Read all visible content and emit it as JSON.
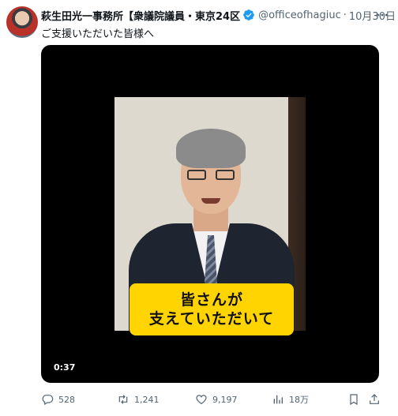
{
  "tweet": {
    "author_name": "萩生田光一事務所【衆議院議員・東京24区",
    "handle": "@officeofhagiuc",
    "separator": "·",
    "date": "10月30日",
    "text": "ご支援いただいた皆様へ"
  },
  "video": {
    "caption_line1": "皆さんが",
    "caption_line2": "支えていただいて",
    "duration": "0:37"
  },
  "actions": {
    "replies": "528",
    "retweets": "1,241",
    "likes": "9,197",
    "views": "18万"
  },
  "colors": {
    "verified": "#1d9bf0",
    "caption_bg": "#ffd400",
    "muted": "#536471"
  },
  "icons": {
    "verified": "verified-badge-icon",
    "more": "more-icon",
    "reply": "reply-icon",
    "retweet": "retweet-icon",
    "like": "heart-icon",
    "views": "views-icon",
    "bookmark": "bookmark-icon",
    "share": "share-icon"
  }
}
